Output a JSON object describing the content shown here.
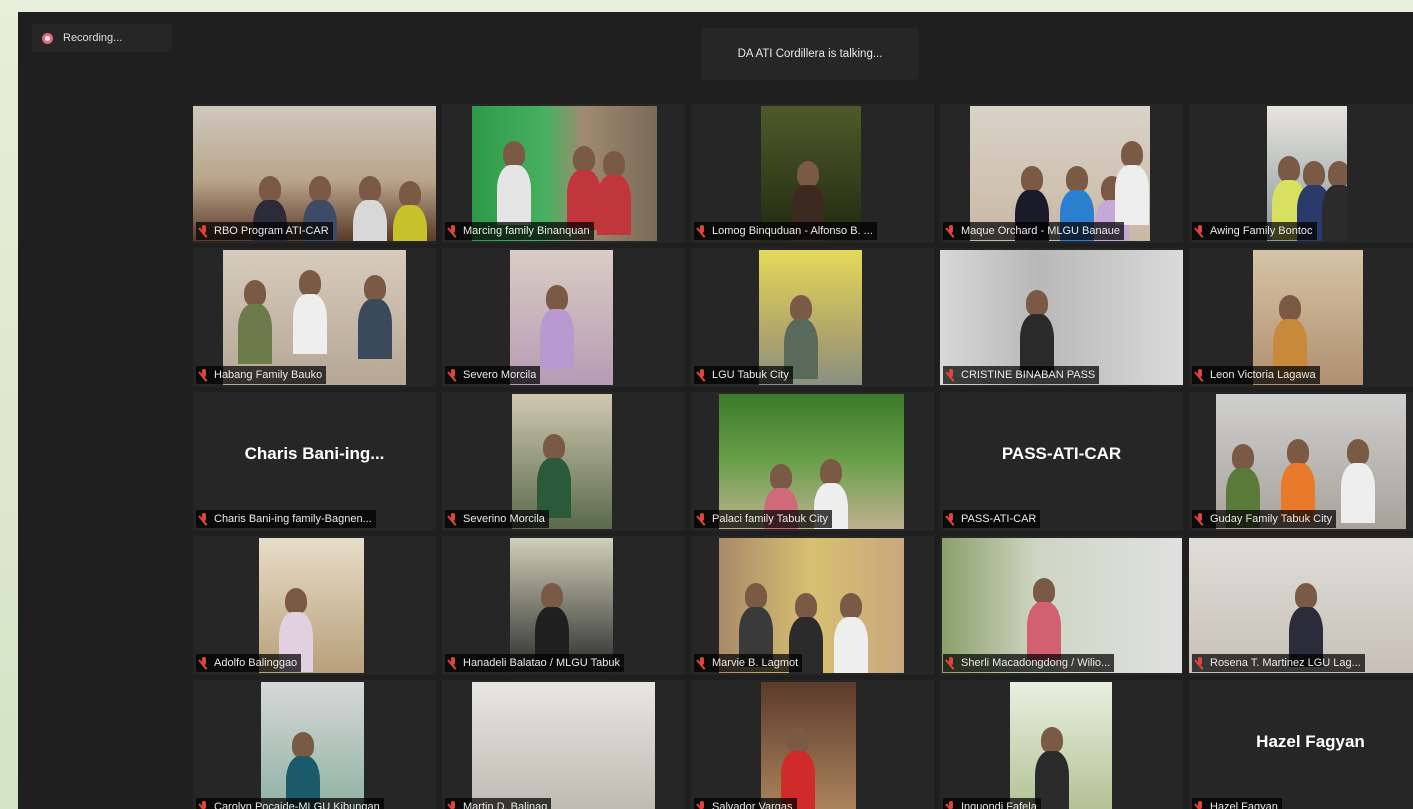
{
  "recording_label": "Recording...",
  "talking_banner": "DA ATI Cordillera is talking...",
  "colors": {
    "mic_muted": "#e0453a",
    "recording_dot": "#e26a7a"
  },
  "participants": [
    {
      "label": "RBO Program ATI-CAR",
      "video": true
    },
    {
      "label": "Marcing family Binanquan",
      "video": true
    },
    {
      "label": "Lomog Binquduan - Alfonso B. ...",
      "video": true
    },
    {
      "label": "Maque Orchard - MLGU Banaue",
      "video": true
    },
    {
      "label": "Awing Family Bontoc",
      "video": true
    },
    {
      "label": "Habang Family Bauko",
      "video": true
    },
    {
      "label": "Severo Morcila",
      "video": true
    },
    {
      "label": "LGU Tabuk City",
      "video": true
    },
    {
      "label": "CRISTINE BINABAN PASS",
      "video": true
    },
    {
      "label": "Leon Victoria Lagawa",
      "video": true
    },
    {
      "label": "Charis Bani-ing family-Bagnen...",
      "video": false,
      "display_name": "Charis  Bani-ing..."
    },
    {
      "label": "Severino Morcila",
      "video": true
    },
    {
      "label": "Palaci family Tabuk City",
      "video": true
    },
    {
      "label": "PASS-ATI-CAR",
      "video": false,
      "display_name": "PASS-ATI-CAR"
    },
    {
      "label": "Guday Family Tabuk City",
      "video": true
    },
    {
      "label": "Adolfo Balinggao",
      "video": true
    },
    {
      "label": "Hanadeli Balatao / MLGU Tabuk",
      "video": true
    },
    {
      "label": "Marvie B. Lagmot",
      "video": true
    },
    {
      "label": "Sherli Macadongdong / Wilio...",
      "video": true
    },
    {
      "label": "Rosena T. Martinez LGU Lag...",
      "video": true
    },
    {
      "label": "Carolyn Pocaide-MLGU Kibungan",
      "video": true
    },
    {
      "label": "Martin D. Balinag",
      "video": true
    },
    {
      "label": "Salvador Vargas",
      "video": true
    },
    {
      "label": "Inguondi Fafela",
      "video": true
    },
    {
      "label": "Hazel Fagyan",
      "video": false,
      "display_name": "Hazel Fagyan"
    }
  ]
}
